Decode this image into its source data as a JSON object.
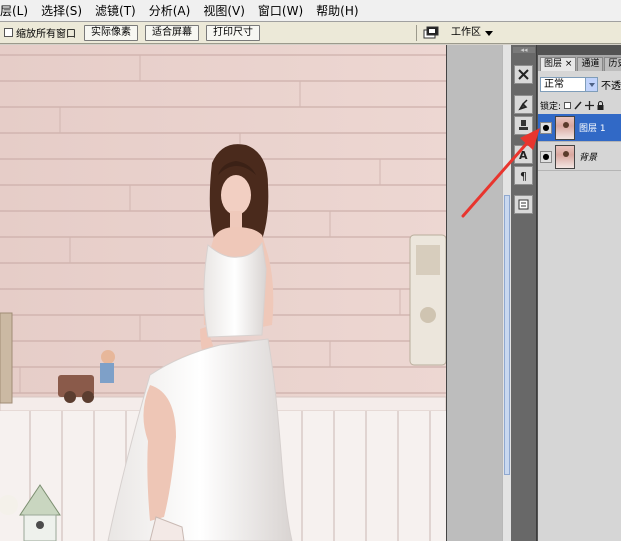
{
  "menu": [
    "层(L)",
    "选择(S)",
    "滤镜(T)",
    "分析(A)",
    "视图(V)",
    "窗口(W)",
    "帮助(H)"
  ],
  "options_bar": {
    "fit_all_windows_label": "缩放所有窗口",
    "buttons": [
      "实际像素",
      "适合屏幕",
      "打印尺寸"
    ],
    "workspace_label": "工作区"
  },
  "layers_panel": {
    "tabs": [
      "图层",
      "通道",
      "历史"
    ],
    "tab_close": "×",
    "blend_mode": "正常",
    "opacity_label": "不透",
    "lock_label": "锁定:",
    "layers": [
      {
        "name": "图层 1",
        "selected": true
      },
      {
        "name": "背景",
        "selected": false
      }
    ]
  },
  "colors": {
    "annotation_arrow": "#e8352e",
    "selection": "#3169c6"
  },
  "icons": [
    "palette-well-icon",
    "tools-icon",
    "brush-icon",
    "stamp-icon",
    "text-icon",
    "paragraph-icon",
    "layer-comp-icon",
    "eye-icon",
    "lock-transparent-icon",
    "lock-brush-icon",
    "lock-move-icon",
    "lock-all-icon"
  ]
}
